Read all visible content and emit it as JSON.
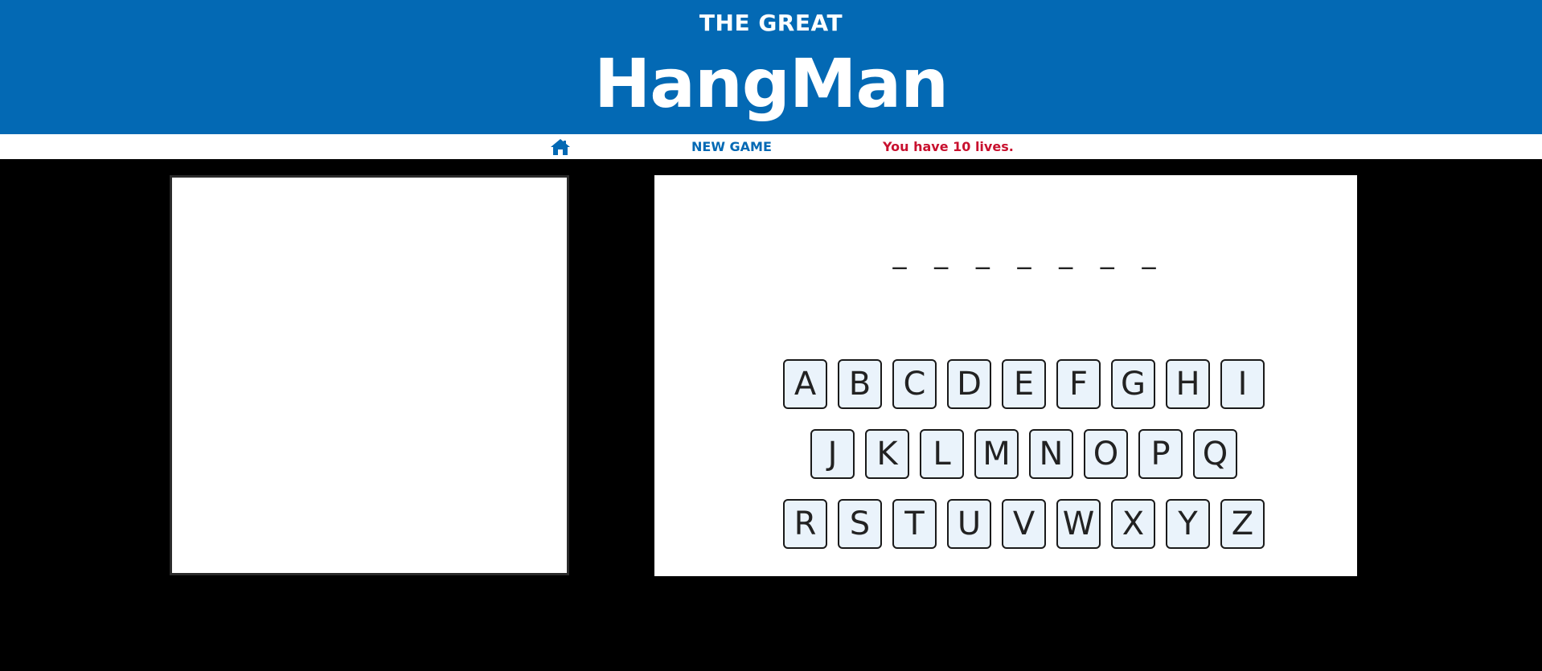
{
  "header": {
    "subtitle": "THE GREAT",
    "title": "HangMan"
  },
  "nav": {
    "home_icon": "home-icon",
    "new_game_label": "NEW GAME",
    "lives_text": "You have 10 lives."
  },
  "word": {
    "blanks": [
      "_",
      "_",
      "_",
      "_",
      "_",
      "_",
      "_"
    ]
  },
  "keyboard": {
    "row1": [
      "A",
      "B",
      "C",
      "D",
      "E",
      "F",
      "G",
      "H",
      "I"
    ],
    "row2": [
      "J",
      "K",
      "L",
      "M",
      "N",
      "O",
      "P",
      "Q"
    ],
    "row3": [
      "R",
      "S",
      "T",
      "U",
      "V",
      "W",
      "X",
      "Y",
      "Z"
    ]
  },
  "colors": {
    "brand_blue": "#0369b4",
    "lives_red": "#c8102e",
    "key_bg": "#eaf3fb"
  }
}
